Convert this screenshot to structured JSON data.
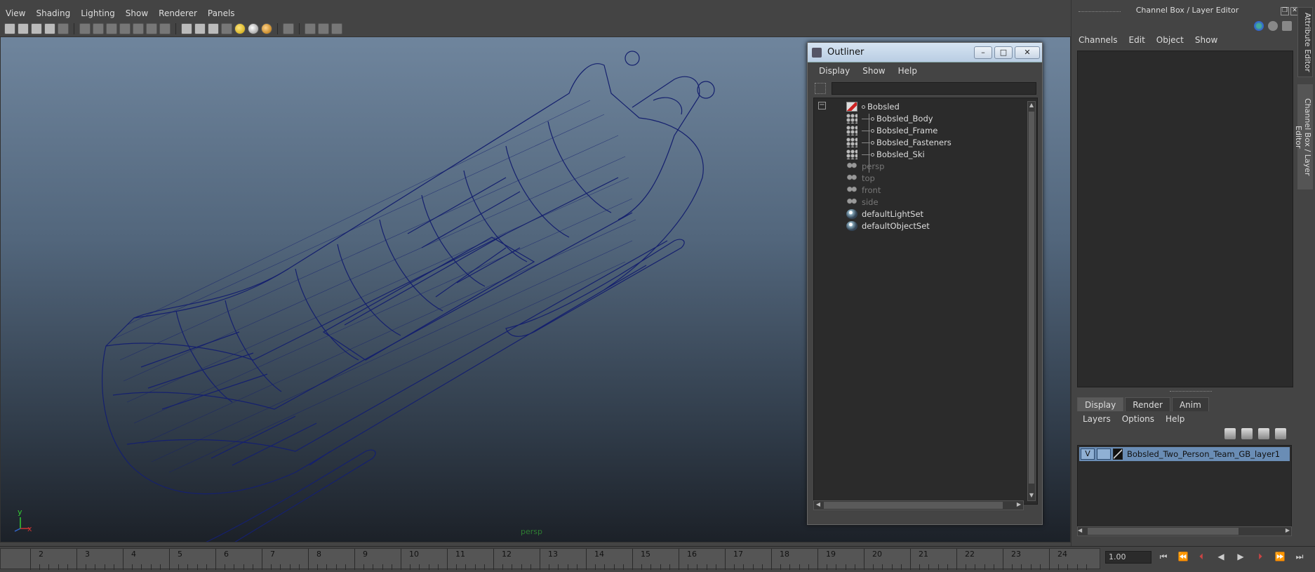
{
  "viewport": {
    "menu": [
      "View",
      "Shading",
      "Lighting",
      "Show",
      "Renderer",
      "Panels"
    ],
    "camera_label": "persp",
    "axis": {
      "x": "x",
      "y": "y"
    }
  },
  "outliner": {
    "title": "Outliner",
    "window_buttons": [
      "–",
      "□",
      "✕"
    ],
    "menu": [
      "Display",
      "Show",
      "Help"
    ],
    "filter_value": "",
    "items": [
      {
        "label": "Bobsled",
        "icon": "group-icon",
        "level": 0,
        "dim": false
      },
      {
        "label": "Bobsled_Body",
        "icon": "mesh-icon",
        "level": 1,
        "dim": false
      },
      {
        "label": "Bobsled_Frame",
        "icon": "mesh-icon",
        "level": 1,
        "dim": false
      },
      {
        "label": "Bobsled_Fasteners",
        "icon": "mesh-icon",
        "level": 1,
        "dim": false
      },
      {
        "label": "Bobsled_Ski",
        "icon": "mesh-icon",
        "level": 1,
        "dim": false
      },
      {
        "label": "persp",
        "icon": "camera-icon",
        "level": 0,
        "dim": true
      },
      {
        "label": "top",
        "icon": "camera-icon",
        "level": 0,
        "dim": true
      },
      {
        "label": "front",
        "icon": "camera-icon",
        "level": 0,
        "dim": true
      },
      {
        "label": "side",
        "icon": "camera-icon",
        "level": 0,
        "dim": true
      },
      {
        "label": "defaultLightSet",
        "icon": "set-icon",
        "level": 0,
        "dim": false
      },
      {
        "label": "defaultObjectSet",
        "icon": "set-icon",
        "level": 0,
        "dim": false
      }
    ]
  },
  "right_panel": {
    "title": "Channel Box / Layer Editor",
    "menu": [
      "Channels",
      "Edit",
      "Object",
      "Show"
    ],
    "tabs": [
      "Display",
      "Render",
      "Anim"
    ],
    "layer_menu": [
      "Layers",
      "Options",
      "Help"
    ],
    "layer": {
      "visibility": "V",
      "name": "Bobsled_Two_Person_Team_GB_layer1"
    },
    "side_tabs": [
      "Attribute Editor",
      "Channel Box / Layer Editor"
    ]
  },
  "timeline": {
    "frames": [
      "2",
      "3",
      "4",
      "5",
      "6",
      "7",
      "8",
      "9",
      "10",
      "11",
      "12",
      "13",
      "14",
      "15",
      "16",
      "17",
      "18",
      "19",
      "20",
      "21",
      "22",
      "23",
      "24"
    ],
    "current_time": "1.00",
    "playback_buttons": [
      "⏮",
      "⏪",
      "⏴",
      "◀",
      "▶",
      "⏵",
      "⏩",
      "⏭"
    ]
  }
}
